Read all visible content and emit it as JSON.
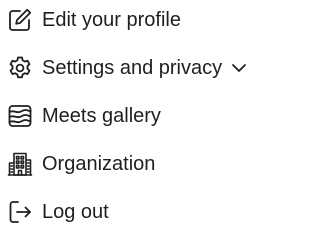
{
  "menu": {
    "items": [
      {
        "label": "Edit your profile",
        "icon": "edit-icon"
      },
      {
        "label": "Settings and privacy",
        "icon": "gear-icon",
        "has_dropdown": true
      },
      {
        "label": "Meets gallery",
        "icon": "gallery-icon"
      },
      {
        "label": "Organization",
        "icon": "building-icon"
      },
      {
        "label": "Log out",
        "icon": "logout-icon"
      }
    ]
  },
  "colors": {
    "text": "#1f1f1f",
    "background": "#ffffff"
  }
}
